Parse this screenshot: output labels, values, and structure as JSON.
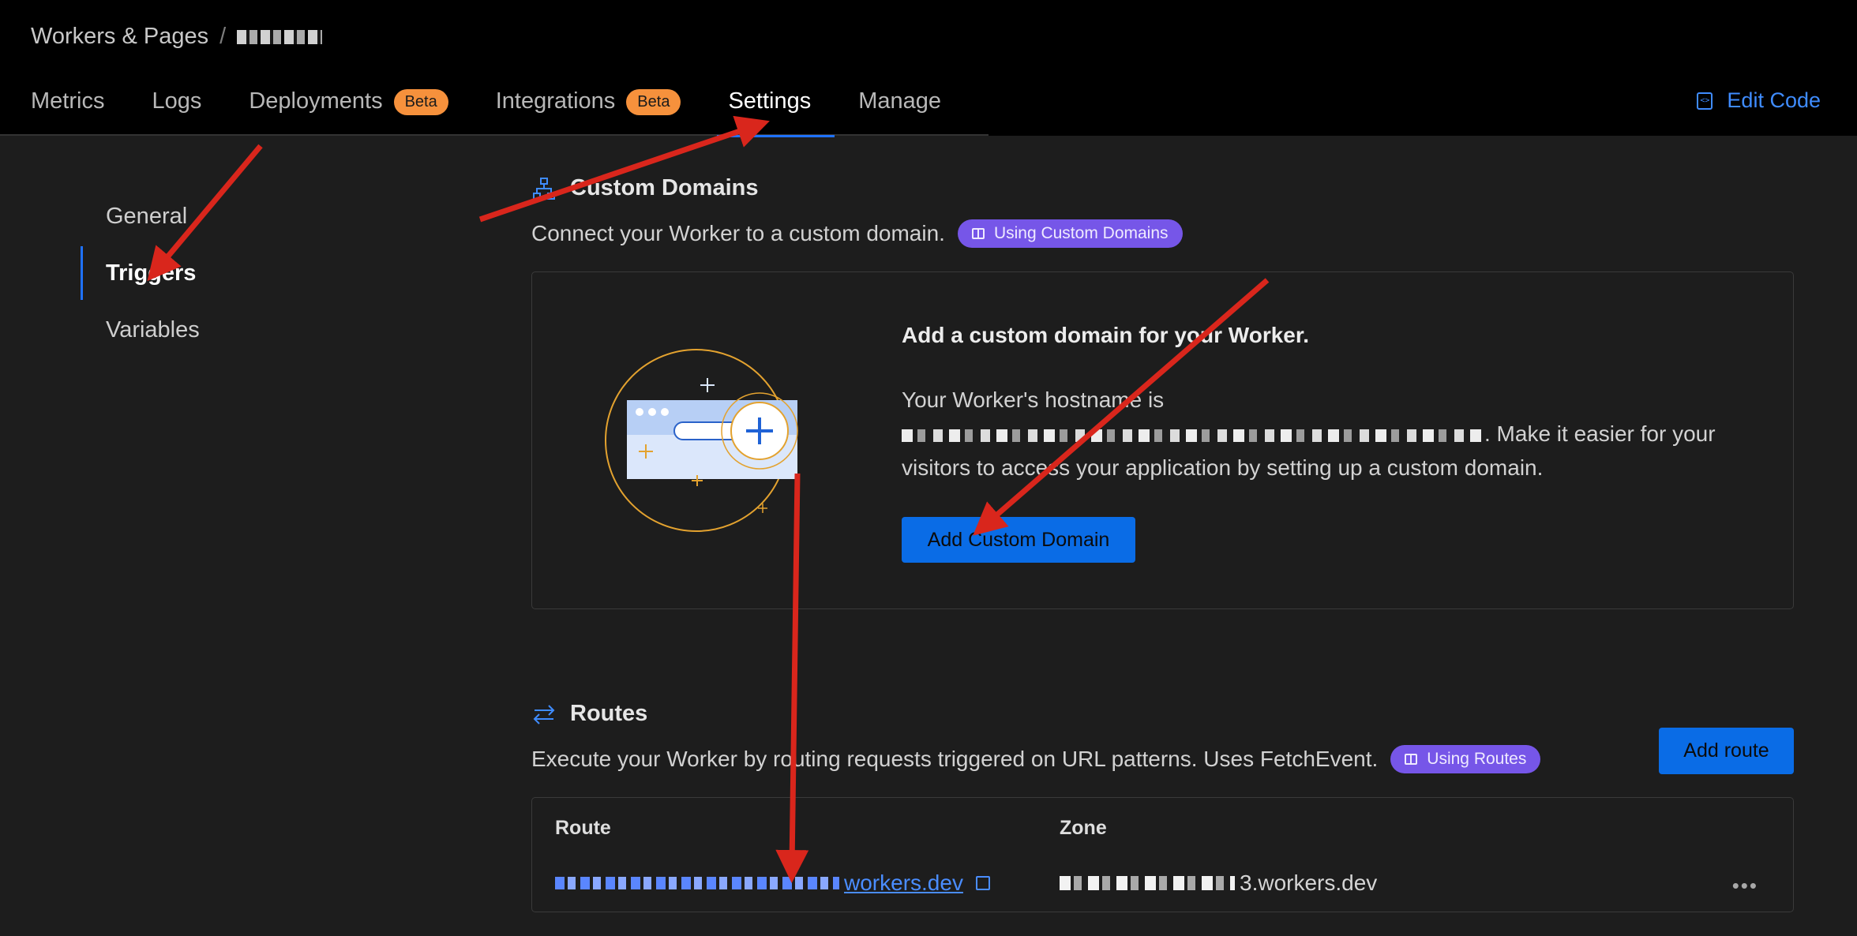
{
  "breadcrumb": {
    "root": "Workers & Pages",
    "separator": "/"
  },
  "tabs": [
    {
      "label": "Metrics"
    },
    {
      "label": "Logs"
    },
    {
      "label": "Deployments",
      "badge": "Beta"
    },
    {
      "label": "Integrations",
      "badge": "Beta"
    },
    {
      "label": "Settings",
      "active": true
    },
    {
      "label": "Manage"
    }
  ],
  "edit_code": "Edit Code",
  "sidebar": {
    "items": [
      {
        "label": "General"
      },
      {
        "label": "Triggers",
        "active": true
      },
      {
        "label": "Variables"
      }
    ]
  },
  "custom_domains": {
    "title": "Custom Domains",
    "description": "Connect your Worker to a custom domain.",
    "doc_link": "Using Custom Domains",
    "card_title": "Add a custom domain for your Worker.",
    "body_line1": "Your Worker's hostname is",
    "body_rest": ". Make it easier for your visitors to access your application by setting up a custom domain.",
    "button": "Add Custom Domain"
  },
  "routes": {
    "title": "Routes",
    "description": "Execute your Worker by routing requests triggered on URL patterns. Uses FetchEvent.",
    "doc_link": "Using Routes",
    "add_button": "Add route",
    "columns": [
      "Route",
      "Zone"
    ],
    "row": {
      "route_suffix": "workers.dev",
      "zone_suffix": "3.workers.dev"
    }
  },
  "colors": {
    "accent": "#1f72ff",
    "beta_badge": "#f6913c",
    "doc_pill": "#7656e8",
    "annotation_arrow": "#d9261c"
  }
}
